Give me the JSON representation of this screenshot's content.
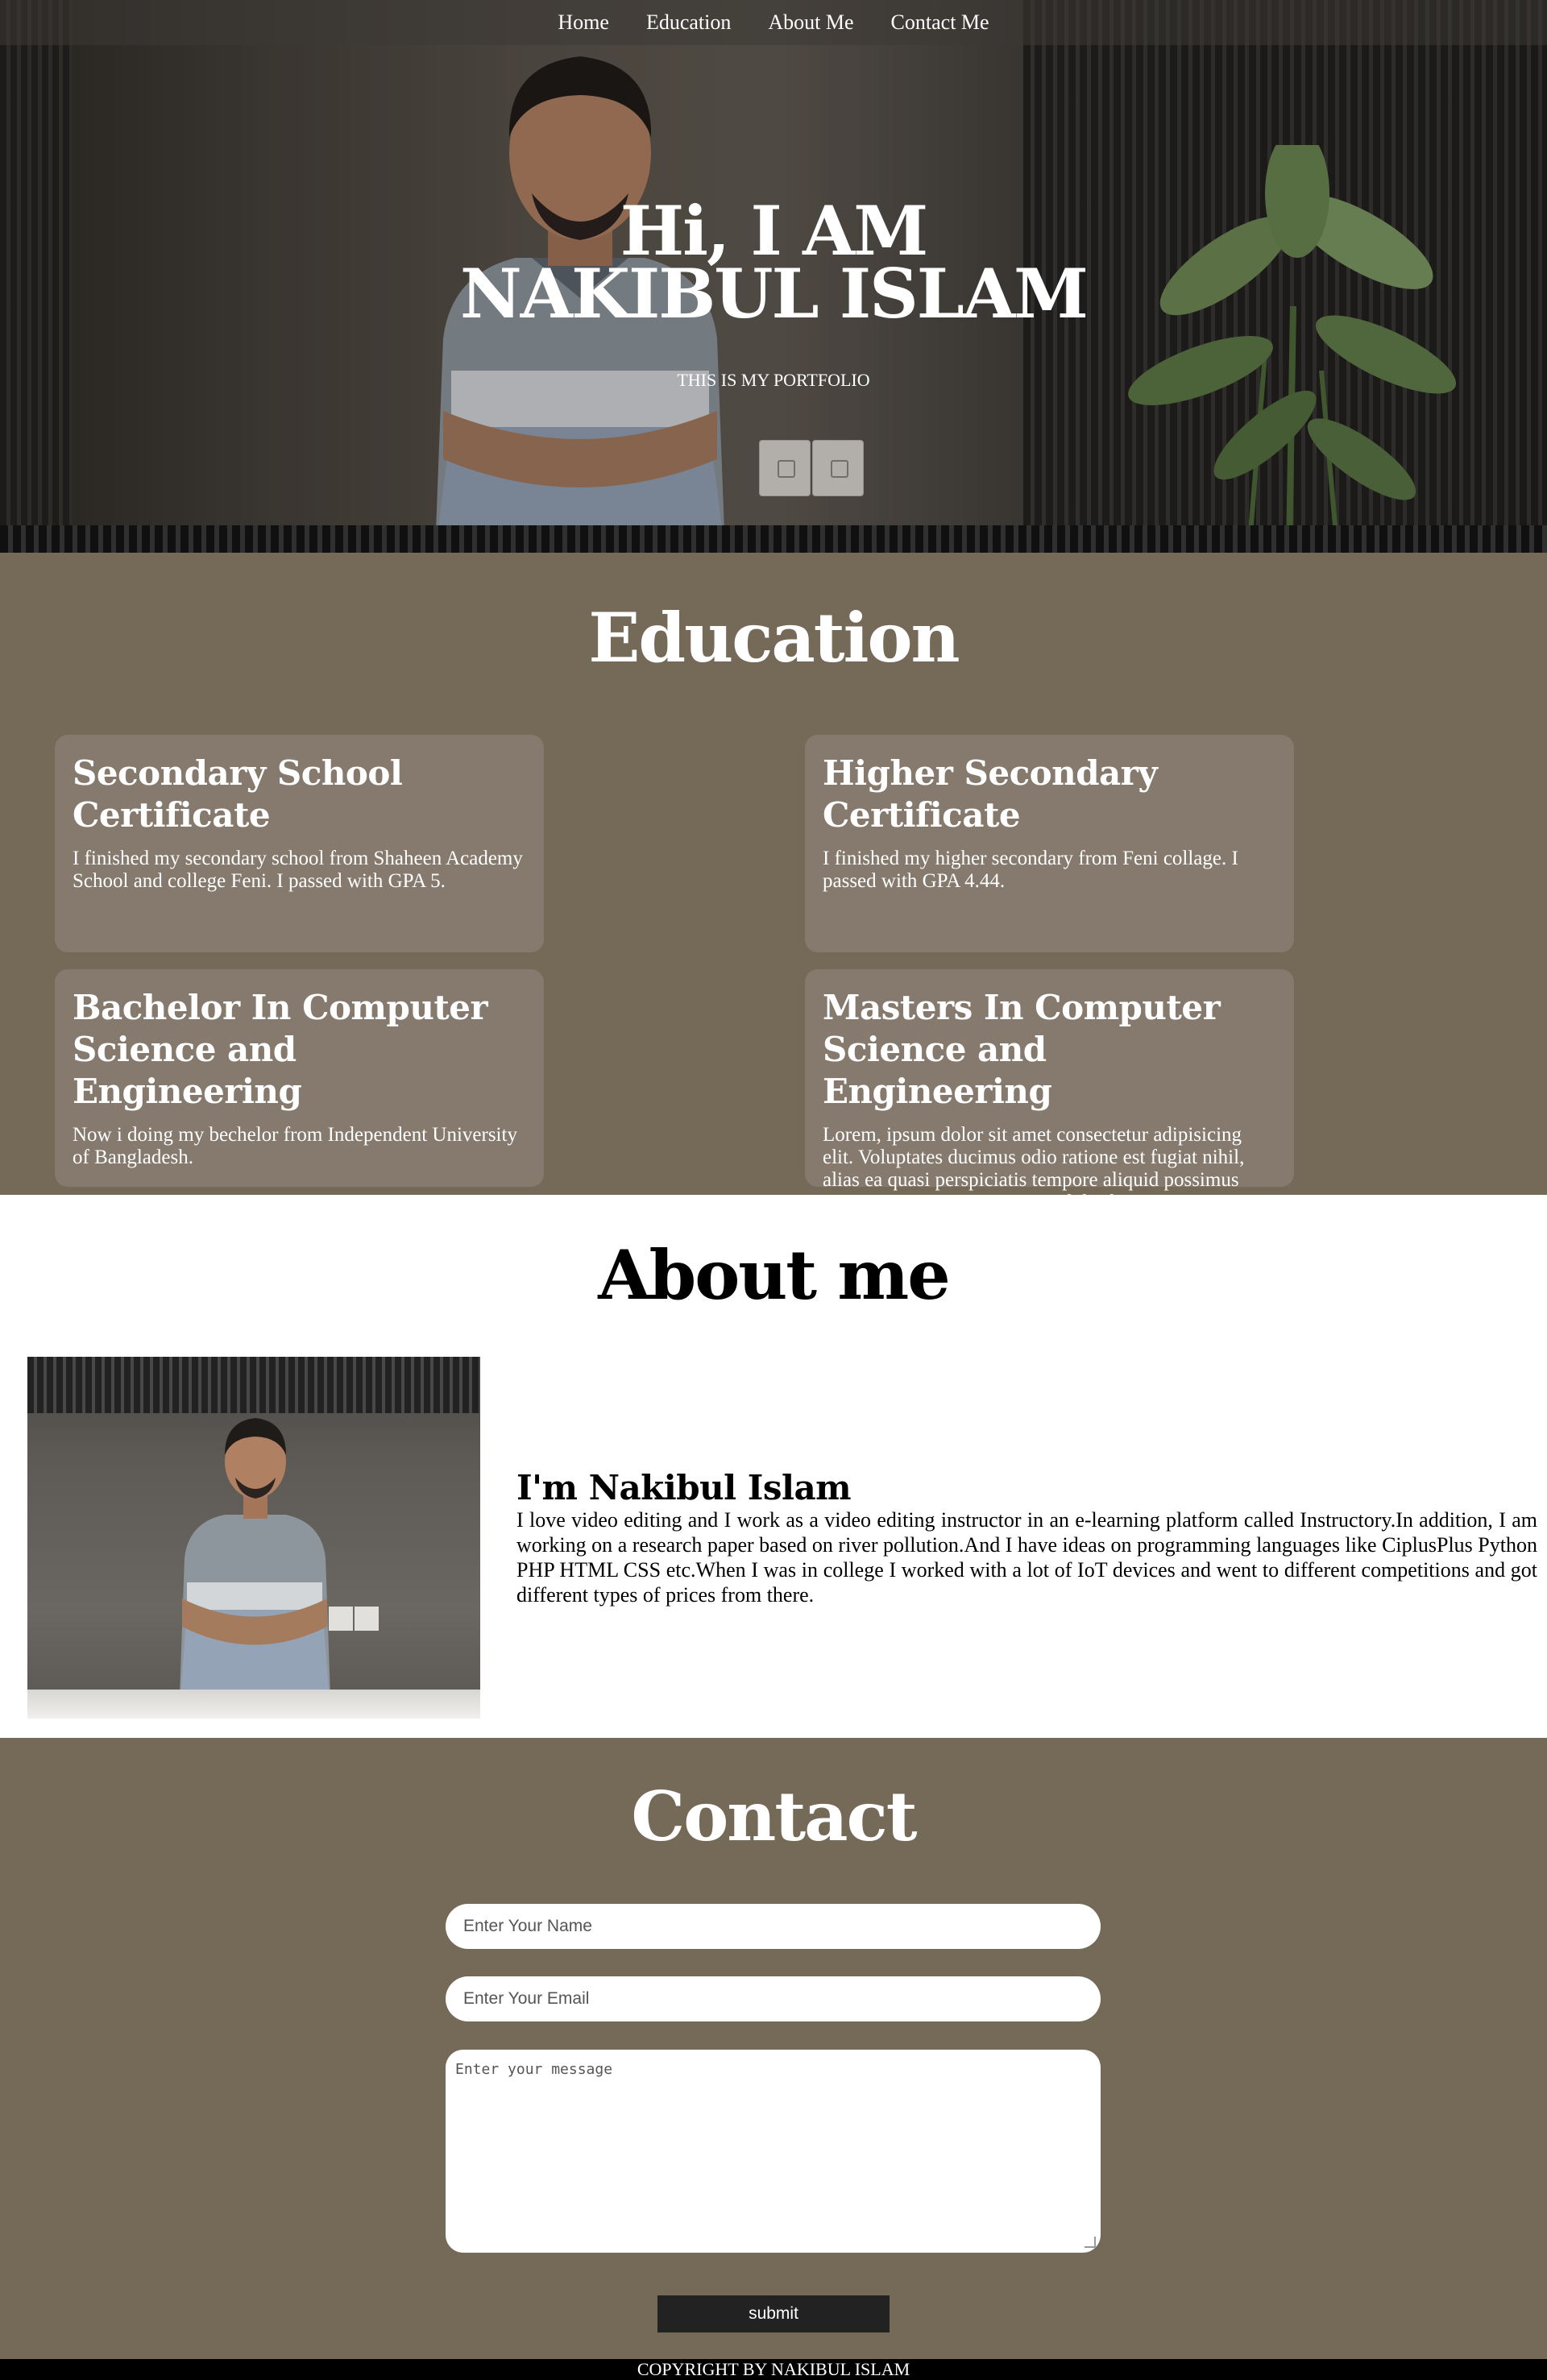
{
  "nav": {
    "items": [
      {
        "label": "Home"
      },
      {
        "label": "Education"
      },
      {
        "label": "About Me"
      },
      {
        "label": "Contact Me"
      }
    ]
  },
  "hero": {
    "title_line1": "Hi, I AM",
    "title_line2": "NAKIBUL ISLAM",
    "subtitle": "THIS IS MY PORTFOLIO"
  },
  "education": {
    "title": "Education",
    "cards": [
      {
        "heading": "Secondary School Certificate",
        "text": "I finished my secondary school from Shaheen Academy School and college Feni. I passed with GPA 5."
      },
      {
        "heading": "Higher Secondary Certificate",
        "text": "I finished my higher secondary from Feni collage. I passed with GPA 4.44."
      },
      {
        "heading": "Bachelor In Computer Science and Engineering",
        "text": "Now i doing my bechelor from Independent University of Bangladesh."
      },
      {
        "heading": "Masters In Computer Science and Engineering",
        "text": "Lorem, ipsum dolor sit amet consectetur adipisicing elit. Voluptates ducimus odio ratione est fugiat nihil, alias ea quasi perspiciatis tempore aliquid possimus maiores sunt atque quisquam doloribus omnis veritatis eveniet."
      }
    ]
  },
  "about": {
    "title": "About me",
    "heading": "I'm Nakibul Islam",
    "text": "I love video editing and I work as a video editing instructor in an e-learning platform called Instructory.In addition, I am working on a research paper based on river pollution.And I have ideas on programming languages like CiplusPlus Python PHP HTML CSS etc.When I was in college I worked with a lot of IoT devices and went to different competitions and got different types of prices from there."
  },
  "contact": {
    "title": "Contact",
    "name_placeholder": "Enter Your Name",
    "email_placeholder": "Enter Your Email",
    "message_placeholder": "Enter your message",
    "submit_label": "submit"
  },
  "footer": {
    "text": "COPYRIGHT BY NAKIBUL ISLAM"
  }
}
